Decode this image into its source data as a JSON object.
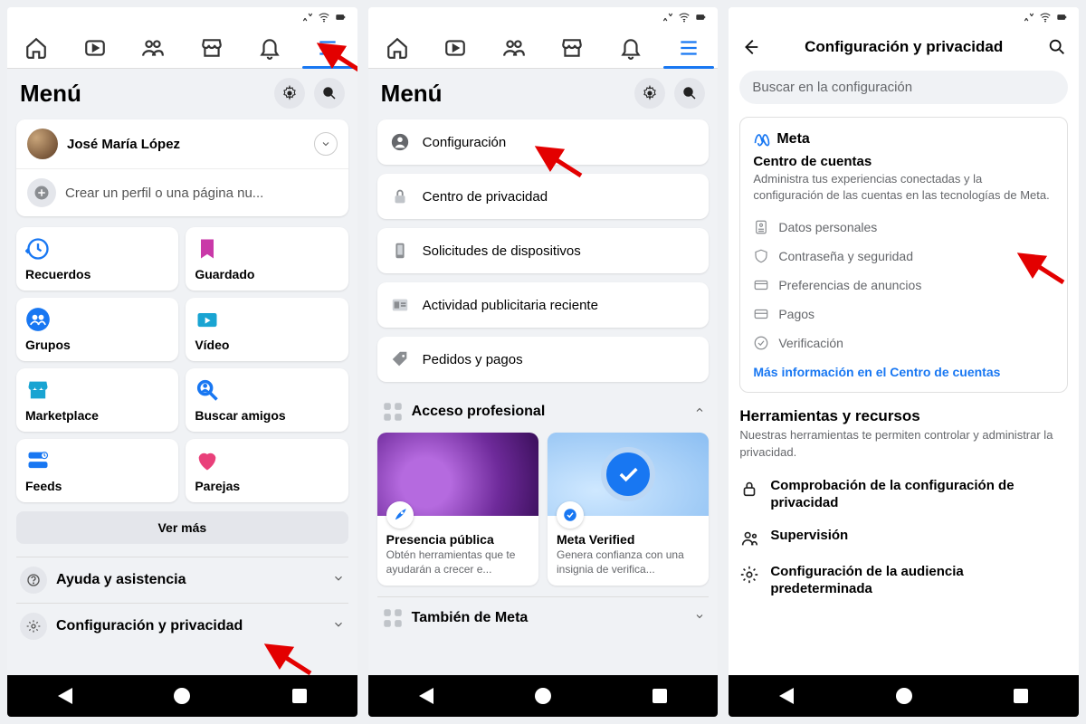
{
  "screen1": {
    "menu_title": "Menú",
    "profile_name": "José María López",
    "create_profile": "Crear un perfil o una página nu...",
    "shortcuts": [
      {
        "label": "Recuerdos"
      },
      {
        "label": "Guardado"
      },
      {
        "label": "Grupos"
      },
      {
        "label": "Vídeo"
      },
      {
        "label": "Marketplace"
      },
      {
        "label": "Buscar amigos"
      },
      {
        "label": "Feeds"
      },
      {
        "label": "Parejas"
      }
    ],
    "see_more": "Ver más",
    "help_label": "Ayuda y asistencia",
    "settings_label": "Configuración y privacidad"
  },
  "screen2": {
    "menu_title": "Menú",
    "settings_items": [
      {
        "label": "Configuración"
      },
      {
        "label": "Centro de privacidad"
      },
      {
        "label": "Solicitudes de dispositivos"
      },
      {
        "label": "Actividad publicitaria reciente"
      },
      {
        "label": "Pedidos y pagos"
      }
    ],
    "pro_access": "Acceso profesional",
    "pro_cards": [
      {
        "title": "Presencia pública",
        "sub": "Obtén herramientas que te ayudarán a crecer e..."
      },
      {
        "title": "Meta Verified",
        "sub": "Genera confianza con una insignia de verifica..."
      }
    ],
    "also_meta": "También de Meta"
  },
  "screen3": {
    "header": "Configuración y privacidad",
    "search_placeholder": "Buscar en la configuración",
    "meta_brand": "Meta",
    "ac_title": "Centro de cuentas",
    "ac_desc": "Administra tus experiencias conectadas y la configuración de las cuentas en las tecnologías de Meta.",
    "ac_rows": [
      "Datos personales",
      "Contraseña y seguridad",
      "Preferencias de anuncios",
      "Pagos",
      "Verificación"
    ],
    "ac_link": "Más información en el Centro de cuentas",
    "tools_title": "Herramientas y recursos",
    "tools_desc": "Nuestras herramientas te permiten controlar y administrar la privacidad.",
    "tool_rows": [
      "Comprobación de la configuración de privacidad",
      "Supervisión",
      "Configuración de la audiencia predeterminada"
    ]
  }
}
